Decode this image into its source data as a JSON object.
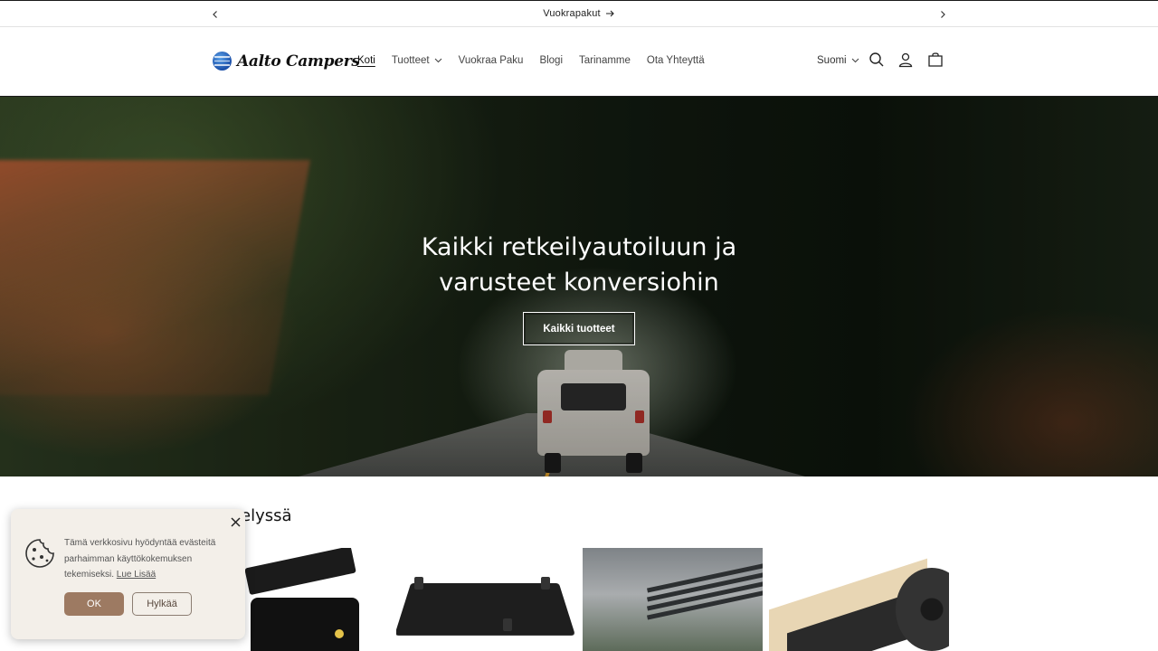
{
  "announcement": {
    "text": "Vuokrapakut"
  },
  "header": {
    "logo_text": "Aalto Campers",
    "nav": [
      {
        "label": "Koti",
        "active": true
      },
      {
        "label": "Tuotteet",
        "dropdown": true
      },
      {
        "label": "Vuokraa Paku"
      },
      {
        "label": "Blogi"
      },
      {
        "label": "Tarinamme"
      },
      {
        "label": "Ota Yhteyttä"
      }
    ],
    "language": "Suomi"
  },
  "hero": {
    "title": "Kaikki retkeilyautoiluun ja varusteet konversiohin",
    "button": "Kaikki tuotteet"
  },
  "featured": {
    "title_visible": "elyssä"
  },
  "cookie": {
    "text": "Tämä verkkosivu hyödyntää evästeitä parhaimman käyttökokemuksen tekemiseksi.",
    "link": "Lue Lisää",
    "ok": "OK",
    "reject": "Hylkää"
  },
  "icons": {
    "prev": "chevron-left-icon",
    "next": "chevron-right-icon",
    "search": "search-icon",
    "account": "user-icon",
    "cart": "cart-icon",
    "cookie": "cookie-icon",
    "close": "close-icon"
  },
  "colors": {
    "accent_ok": "#9d7a62",
    "text": "#121212",
    "popup_bg": "#f3efe9"
  }
}
